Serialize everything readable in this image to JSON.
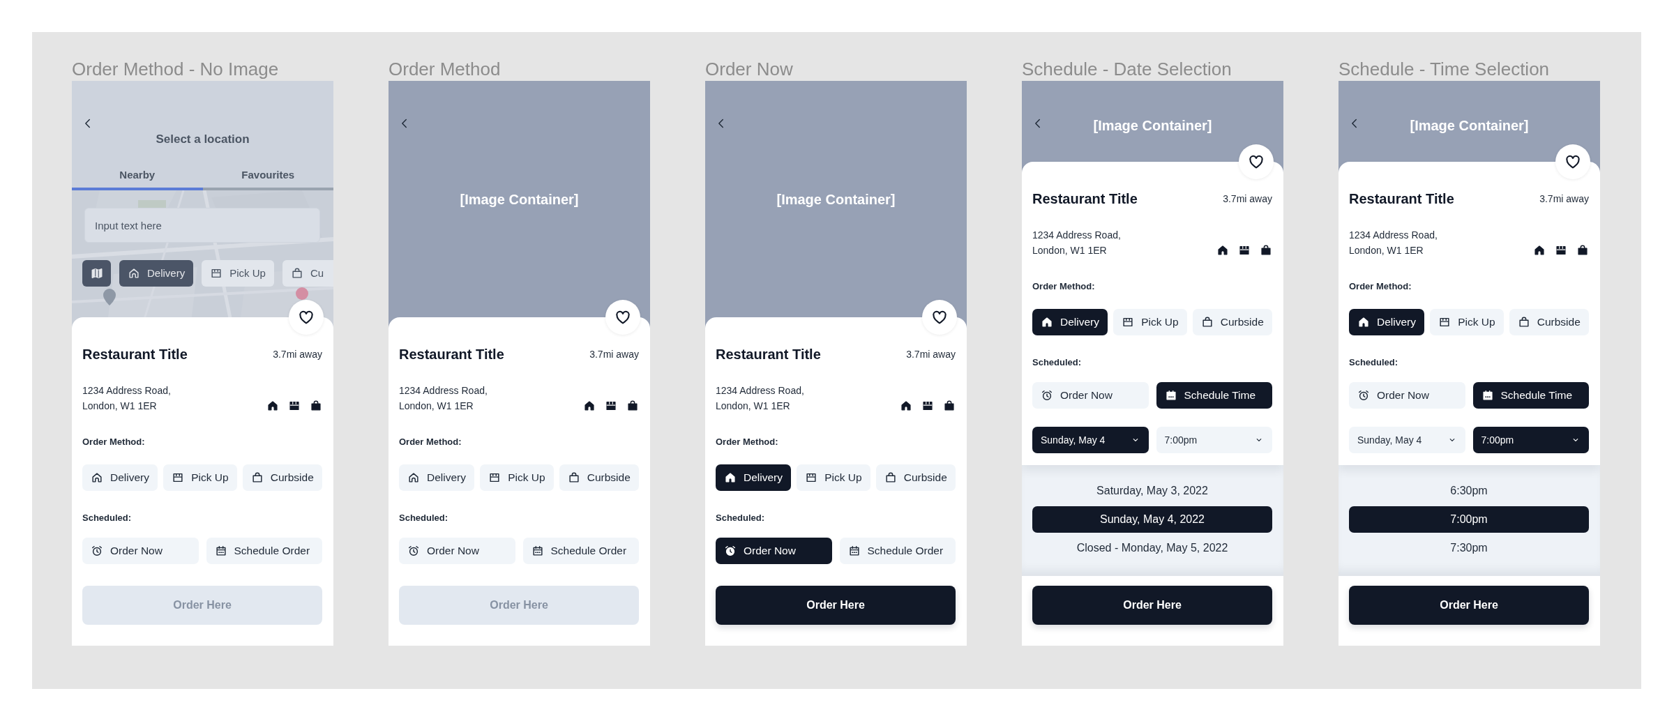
{
  "frames": [
    {
      "frame_title": "Order Method - No Image",
      "header": {
        "kind": "map",
        "title": "Select a location",
        "tabs": [
          {
            "label": "Nearby",
            "selected": true
          },
          {
            "label": "Favourites",
            "selected": false
          }
        ],
        "search": {
          "placeholder": "Input text here"
        },
        "chips": [
          {
            "kind": "map",
            "selected": true
          },
          {
            "kind": "delivery",
            "label": "Delivery",
            "selected": true
          },
          {
            "kind": "pickup",
            "label": "Pick Up",
            "selected": false
          },
          {
            "kind": "curbside",
            "label": "Cu",
            "selected": false
          }
        ]
      },
      "restaurant": {
        "title": "Restaurant Title",
        "distance": "3.7mi away",
        "address_lines": [
          "1234 Address Road,",
          "London, W1 1ER"
        ]
      },
      "order_method": {
        "label": "Order Method:",
        "options": [
          {
            "kind": "delivery",
            "label": "Delivery",
            "selected": false
          },
          {
            "kind": "pickup",
            "label": "Pick Up",
            "selected": false
          },
          {
            "kind": "curbside",
            "label": "Curbside",
            "selected": false
          }
        ]
      },
      "scheduled": {
        "label": "Scheduled:",
        "options": [
          {
            "kind": "now",
            "label": "Order Now",
            "selected": false
          },
          {
            "kind": "schedule",
            "label": "Schedule Order",
            "selected": false
          }
        ]
      },
      "order_button": {
        "label": "Order Here",
        "disabled": true
      }
    },
    {
      "frame_title": "Order Method",
      "header": {
        "label": "[Image Container]"
      },
      "restaurant": {
        "title": "Restaurant Title",
        "distance": "3.7mi away",
        "address_lines": [
          "1234 Address Road,",
          "London, W1 1ER"
        ]
      },
      "order_method": {
        "label": "Order Method:",
        "options": [
          {
            "kind": "delivery",
            "label": "Delivery",
            "selected": false
          },
          {
            "kind": "pickup",
            "label": "Pick Up",
            "selected": false
          },
          {
            "kind": "curbside",
            "label": "Curbside",
            "selected": false
          }
        ]
      },
      "scheduled": {
        "label": "Scheduled:",
        "options": [
          {
            "kind": "now",
            "label": "Order Now",
            "selected": false
          },
          {
            "kind": "schedule",
            "label": "Schedule Order",
            "selected": false
          }
        ]
      },
      "order_button": {
        "label": "Order Here",
        "disabled": true
      }
    },
    {
      "frame_title": "Order Now",
      "header": {
        "label": "[Image Container]"
      },
      "restaurant": {
        "title": "Restaurant Title",
        "distance": "3.7mi away",
        "address_lines": [
          "1234 Address Road,",
          "London, W1 1ER"
        ]
      },
      "order_method": {
        "label": "Order Method:",
        "options": [
          {
            "kind": "delivery",
            "label": "Delivery",
            "selected": true
          },
          {
            "kind": "pickup",
            "label": "Pick Up",
            "selected": false
          },
          {
            "kind": "curbside",
            "label": "Curbside",
            "selected": false
          }
        ]
      },
      "scheduled": {
        "label": "Scheduled:",
        "options": [
          {
            "kind": "now",
            "label": "Order Now",
            "selected": true
          },
          {
            "kind": "schedule",
            "label": "Schedule Order",
            "selected": false
          }
        ]
      },
      "order_button": {
        "label": "Order Here",
        "disabled": false
      }
    },
    {
      "frame_title": "Schedule - Date Selection",
      "header": {
        "label": "[Image Container]"
      },
      "restaurant": {
        "title": "Restaurant Title",
        "distance": "3.7mi away",
        "address_lines": [
          "1234 Address Road,",
          "London, W1 1ER"
        ]
      },
      "order_method": {
        "label": "Order Method:",
        "options": [
          {
            "kind": "delivery",
            "label": "Delivery",
            "selected": true
          },
          {
            "kind": "pickup",
            "label": "Pick Up",
            "selected": false
          },
          {
            "kind": "curbside",
            "label": "Curbside",
            "selected": false
          }
        ]
      },
      "scheduled": {
        "label": "Scheduled:",
        "options": [
          {
            "kind": "now",
            "label": "Order Now",
            "selected": false
          },
          {
            "kind": "schedule",
            "label": "Schedule Time",
            "selected": true
          }
        ]
      },
      "pickers": [
        {
          "value": "Sunday, May 4",
          "selected": true
        },
        {
          "value": "7:00pm",
          "selected": false
        }
      ],
      "picker_list": {
        "items": [
          {
            "text": "Saturday, May 3, 2022",
            "selected": false
          },
          {
            "text": "Sunday, May 4, 2022",
            "selected": true
          },
          {
            "text": "Closed - Monday, May 5, 2022",
            "selected": false
          }
        ]
      },
      "order_button": {
        "label": "Order Here",
        "disabled": false
      }
    },
    {
      "frame_title": "Schedule - Time Selection",
      "header": {
        "label": "[Image Container]"
      },
      "restaurant": {
        "title": "Restaurant Title",
        "distance": "3.7mi away",
        "address_lines": [
          "1234 Address Road,",
          "London, W1 1ER"
        ]
      },
      "order_method": {
        "label": "Order Method:",
        "options": [
          {
            "kind": "delivery",
            "label": "Delivery",
            "selected": true
          },
          {
            "kind": "pickup",
            "label": "Pick Up",
            "selected": false
          },
          {
            "kind": "curbside",
            "label": "Curbside",
            "selected": false
          }
        ]
      },
      "scheduled": {
        "label": "Scheduled:",
        "options": [
          {
            "kind": "now",
            "label": "Order Now",
            "selected": false
          },
          {
            "kind": "schedule",
            "label": "Schedule Time",
            "selected": true
          }
        ]
      },
      "pickers": [
        {
          "value": "Sunday, May 4",
          "selected": false
        },
        {
          "value": "7:00pm",
          "selected": true
        }
      ],
      "picker_list": {
        "items": [
          {
            "text": "6:30pm",
            "selected": false
          },
          {
            "text": "7:00pm",
            "selected": true
          },
          {
            "text": "7:30pm",
            "selected": false
          }
        ]
      },
      "order_button": {
        "label": "Order Here",
        "disabled": false
      }
    }
  ]
}
